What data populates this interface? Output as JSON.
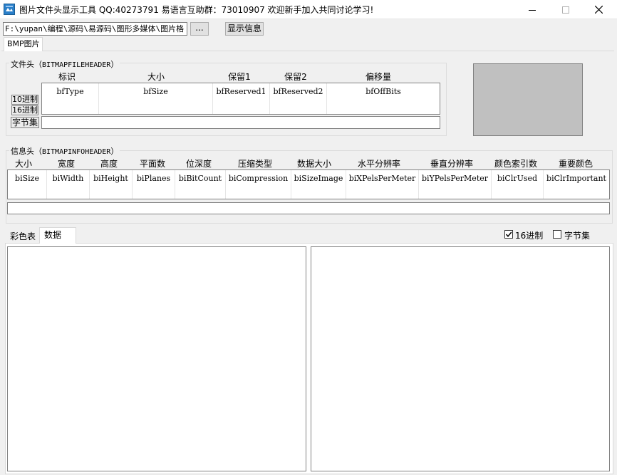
{
  "window": {
    "title": "图片文件头显示工具 QQ:40273791 易语言互助群：73010907 欢迎新手加入共同讨论学习!",
    "icons": {
      "app": "app-logo-icon",
      "minimize": "minimize-icon",
      "maximize": "maximize-icon",
      "close": "close-icon"
    }
  },
  "toolbar": {
    "path_value": "F:\\yupan\\编程\\源码\\易源码\\图形多媒体\\图片格",
    "browse_label": "...",
    "show_label": "显示信息"
  },
  "tabs_top": [
    {
      "label": "BMP图片",
      "active": true
    }
  ],
  "file_header": {
    "legend_cn": "文件头（",
    "legend_en": "BITMAPFILEHEADER",
    "legend_end": "）",
    "headers": [
      "标识",
      "大小",
      "保留1",
      "保留2",
      "偏移量"
    ],
    "fields": [
      "bfType",
      "bfSize",
      "bfReserved1",
      "bfReserved2",
      "bfOffBits"
    ],
    "dec_button": "10进制",
    "hex_button": "16进制",
    "bytes_button": "字节集"
  },
  "info_header": {
    "legend_cn": "信息头（",
    "legend_en": "BITMAPINFOHEADER",
    "legend_end": "）",
    "headers": [
      "大小",
      "宽度",
      "高度",
      "平面数",
      "位深度",
      "压缩类型",
      "数据大小",
      "水平分辨率",
      "垂直分辨率",
      "颜色索引数",
      "重要颜色"
    ],
    "fields": [
      "biSize",
      "biWidth",
      "biHeight",
      "biPlanes",
      "biBitCount",
      "biCompression",
      "biSizeImage",
      "biXPelsPerMeter",
      "biYPelsPerMeter",
      "biClrUsed",
      "biClrImportant"
    ]
  },
  "tabs_bottom": [
    {
      "label": "彩色表",
      "active": false
    },
    {
      "label": "数据",
      "active": true
    }
  ],
  "options": {
    "hex_checkbox": {
      "label": "16进制",
      "checked": true
    },
    "bytes_checkbox": {
      "label": "字节集",
      "checked": false
    }
  },
  "colors": {
    "preview_fill": "#c0c0c0",
    "titlebar": "#ffffff",
    "window_bg": "#f0f0f0"
  }
}
